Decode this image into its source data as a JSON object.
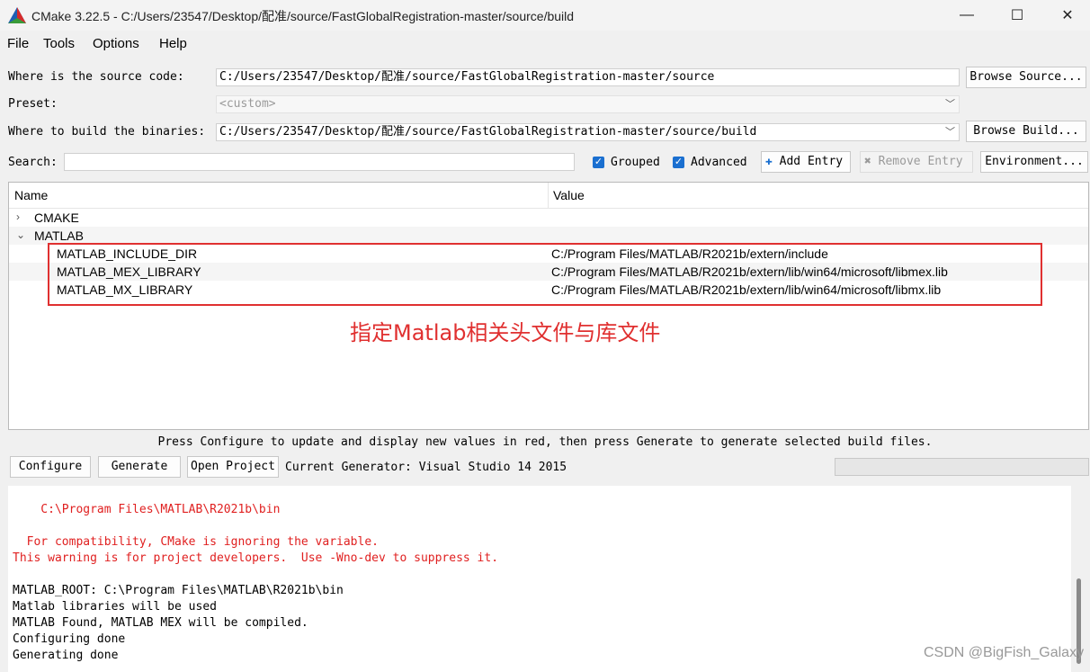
{
  "window": {
    "title": "CMake 3.22.5 - C:/Users/23547/Desktop/配准/source/FastGlobalRegistration-master/source/build",
    "minimize": "—",
    "maximize": "☐",
    "close": "✕"
  },
  "menu": {
    "file": "File",
    "tools": "Tools",
    "options": "Options",
    "help": "Help"
  },
  "source": {
    "label": "Where is the source code:",
    "value": "C:/Users/23547/Desktop/配准/source/FastGlobalRegistration-master/source",
    "browse": "Browse Source..."
  },
  "preset": {
    "label": "Preset:",
    "value": "<custom>"
  },
  "build": {
    "label": "Where to build the binaries:",
    "value": "C:/Users/23547/Desktop/配准/source/FastGlobalRegistration-master/source/build",
    "browse": "Browse Build..."
  },
  "search": {
    "label": "Search:",
    "value": ""
  },
  "options": {
    "grouped": "Grouped",
    "advanced": "Advanced",
    "add_entry": "Add Entry",
    "remove_entry": "Remove Entry",
    "environment": "Environment..."
  },
  "tree": {
    "col_name": "Name",
    "col_value": "Value",
    "groups": [
      {
        "name": "CMAKE",
        "expanded": false
      },
      {
        "name": "MATLAB",
        "expanded": true
      }
    ],
    "entries": [
      {
        "name": "MATLAB_INCLUDE_DIR",
        "value": "C:/Program Files/MATLAB/R2021b/extern/include"
      },
      {
        "name": "MATLAB_MEX_LIBRARY",
        "value": "C:/Program Files/MATLAB/R2021b/extern/lib/win64/microsoft/libmex.lib"
      },
      {
        "name": "MATLAB_MX_LIBRARY",
        "value": "C:/Program Files/MATLAB/R2021b/extern/lib/win64/microsoft/libmx.lib"
      }
    ]
  },
  "annotation": "指定Matlab相关头文件与库文件",
  "hint": "Press Configure to update and display new values in red, then press Generate to generate selected build files.",
  "actions": {
    "configure": "Configure",
    "generate": "Generate",
    "open_project": "Open Project",
    "generator": "Current Generator: Visual Studio 14 2015"
  },
  "output": {
    "lines": [
      "    C:\\Program Files\\MATLAB\\R2021b\\bin",
      "  For compatibility, CMake is ignoring the variable.",
      "This warning is for project developers.  Use -Wno-dev to suppress it.",
      "MATLAB_ROOT: C:\\Program Files\\MATLAB\\R2021b\\bin",
      "Matlab libraries will be used",
      "MATLAB Found, MATLAB MEX will be compiled.",
      "Configuring done",
      "Generating done"
    ]
  },
  "watermark": "CSDN @BigFish_Galaxy",
  "colors": {
    "accent": "#1a6fd0",
    "warning_red": "#e02020",
    "annotation_red": "#e03030"
  }
}
